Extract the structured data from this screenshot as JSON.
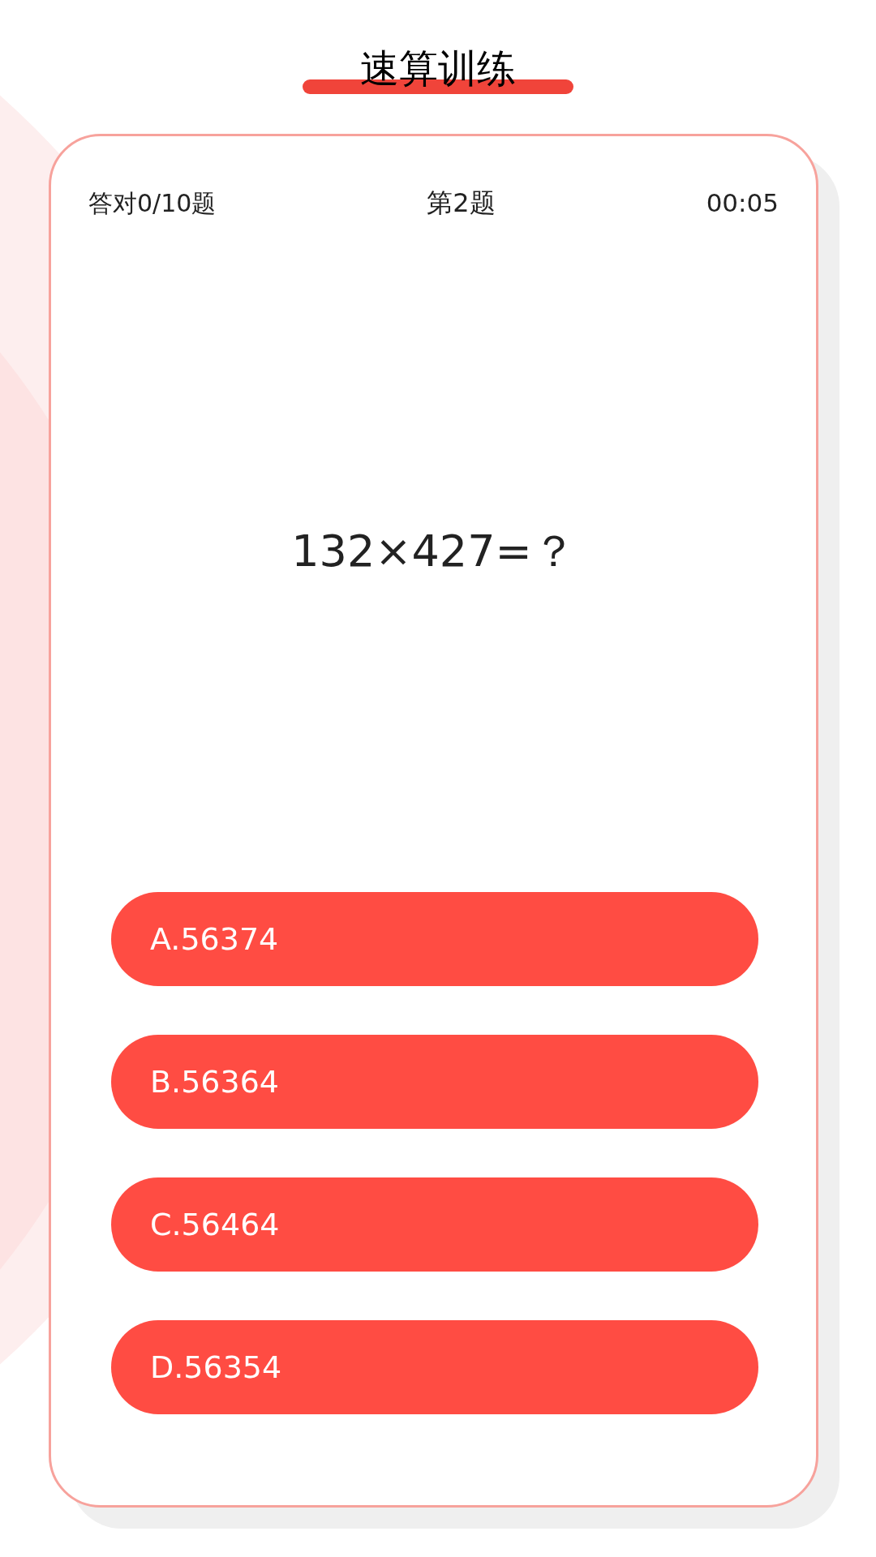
{
  "title": "速算训练",
  "status": {
    "correct": "答对0/10题",
    "question_number": "第2题",
    "timer": "00:05"
  },
  "question": "132×427=？",
  "options": [
    {
      "label": "A.56374"
    },
    {
      "label": "B.56364"
    },
    {
      "label": "C.56464"
    },
    {
      "label": "D.56354"
    }
  ]
}
